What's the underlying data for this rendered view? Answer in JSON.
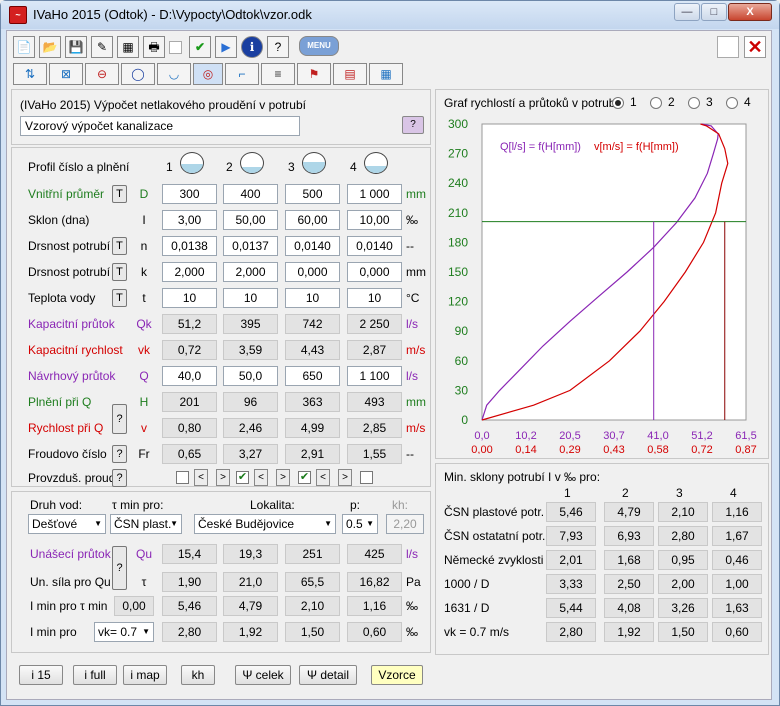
{
  "title": "IVaHo 2015 (Odtok) - D:\\Vypocty\\Odtok\\vzor.odk",
  "window": {
    "minimize": "—",
    "maximize": "□",
    "close": "X"
  },
  "toolbar1": [
    "new-file-icon",
    "open-folder-icon",
    "save-icon",
    "edit-icon",
    "table-icon",
    "print-icon",
    "check-icon",
    "play-icon",
    "info-icon",
    "help-icon",
    "menu-button"
  ],
  "menu_label": "MENU",
  "header": {
    "heading": "(IVaHo 2015) Výpočet netlakového proudění v potrubí",
    "name": "Vzorový výpočet kanalizace",
    "q": "?"
  },
  "profile": {
    "label": "Profil číslo a plnění",
    "numbers": [
      "1",
      "2",
      "3",
      "4"
    ],
    "fills": [
      0.45,
      0.3,
      0.55,
      0.35
    ]
  },
  "rows": [
    {
      "label": "Vnitřní průměr",
      "t": "T",
      "sym": "D",
      "unit": "mm",
      "vals": [
        "300",
        "400",
        "500",
        "1 000"
      ],
      "color": "green",
      "editable": true
    },
    {
      "label": "Sklon (dna)",
      "t": "",
      "sym": "I",
      "unit": "‰",
      "vals": [
        "3,00",
        "50,00",
        "60,00",
        "10,00"
      ],
      "color": "black",
      "editable": true
    },
    {
      "label": "Drsnost potrubí",
      "t": "T",
      "sym": "n",
      "unit": "--",
      "vals": [
        "0,0138",
        "0,0137",
        "0,0140",
        "0,0140"
      ],
      "color": "black",
      "editable": true
    },
    {
      "label": "Drsnost potrubí",
      "t": "T",
      "sym": "k",
      "unit": "mm",
      "vals": [
        "2,000",
        "2,000",
        "0,000",
        "0,000"
      ],
      "color": "black",
      "editable": true
    },
    {
      "label": "Teplota vody",
      "t": "T",
      "sym": "t",
      "unit": "°C",
      "vals": [
        "10",
        "10",
        "10",
        "10"
      ],
      "color": "black",
      "editable": true
    },
    {
      "label": "Kapacitní průtok",
      "t": "",
      "sym": "Qk",
      "unit": "l/s",
      "vals": [
        "51,2",
        "395",
        "742",
        "2 250"
      ],
      "color": "purple",
      "editable": false
    },
    {
      "label": "Kapacitní rychlost",
      "t": "",
      "sym": "vk",
      "unit": "m/s",
      "vals": [
        "0,72",
        "3,59",
        "4,43",
        "2,87"
      ],
      "color": "red",
      "editable": false
    },
    {
      "label": "Návrhový průtok",
      "t": "",
      "sym": "Q",
      "unit": "l/s",
      "vals": [
        "40,0",
        "50,0",
        "650",
        "1 100"
      ],
      "color": "purple",
      "editable": true
    },
    {
      "label": "Plnění při Q",
      "t": "",
      "sym": "H",
      "unit": "mm",
      "vals": [
        "201",
        "96",
        "363",
        "493"
      ],
      "color": "green",
      "editable": false
    },
    {
      "label": "Rychlost při Q",
      "t": "",
      "sym": "v",
      "unit": "m/s",
      "vals": [
        "0,80",
        "2,46",
        "4,99",
        "2,85"
      ],
      "color": "red",
      "editable": false
    },
    {
      "label": "Froudovo číslo",
      "t": "?",
      "sym": "Fr",
      "unit": "--",
      "vals": [
        "0,65",
        "3,27",
        "2,91",
        "1,55"
      ],
      "color": "black",
      "editable": false
    }
  ],
  "qh_button": "?",
  "provzdus": {
    "label": "Provzduš. proud",
    "q": "?",
    "checked": [
      false,
      true,
      true,
      false
    ],
    "lt": "<",
    "gt": ">"
  },
  "lower": {
    "druh_label": "Druh vod:",
    "tau_label": "τ min pro:",
    "lok_label": "Lokalita:",
    "p_label": "p:",
    "kh_label": "kh:",
    "druh": "Dešťové",
    "tau": "ČSN plast.",
    "lokalita": "České Budějovice",
    "p": "0.5",
    "kh": "2,20",
    "rows": [
      {
        "label": "Unášecí průtok",
        "sym": "Qu",
        "unit": "l/s",
        "vals": [
          "15,4",
          "19,3",
          "251",
          "425"
        ],
        "color": "purple"
      },
      {
        "label": "Un. síla pro Qu",
        "sym": "τ",
        "unit": "Pa",
        "vals": [
          "1,90",
          "21,0",
          "65,5",
          "16,82"
        ],
        "color": "black"
      },
      {
        "label": "I min pro τ min",
        "sym": "0,00",
        "unit": "‰",
        "vals": [
          "5,46",
          "4,79",
          "2,10",
          "1,16"
        ],
        "color": "black"
      },
      {
        "label": "I min pro",
        "sym": "vk= 0.7",
        "unit": "‰",
        "vals": [
          "2,80",
          "1,92",
          "1,50",
          "0,60"
        ],
        "color": "black"
      }
    ],
    "q": "?"
  },
  "buttons": [
    "i 15",
    "i full",
    "i map",
    "kh",
    "Ψ celek",
    "Ψ detail",
    "Vzorce"
  ],
  "graph": {
    "label": "Graf rychlostí a průtoků v potrubí",
    "radios": [
      "1",
      "2",
      "3",
      "4"
    ],
    "selected": 0
  },
  "chart_data": {
    "type": "line",
    "title": "",
    "legend": [
      "Q[l/s] = f(H[mm])",
      "v[m/s] = f(H[mm])"
    ],
    "ylim": [
      0,
      300
    ],
    "yticks": [
      "300",
      "270",
      "240",
      "210",
      "180",
      "150",
      "120",
      "90",
      "60",
      "30",
      "0"
    ],
    "xticks_Q": [
      "0,0",
      "10,2",
      "20,5",
      "30,7",
      "41,0",
      "51,2",
      "61,5"
    ],
    "xticks_v": [
      "0,00",
      "0,14",
      "0,29",
      "0,43",
      "0,58",
      "0,72",
      "0,87"
    ],
    "series": [
      {
        "name": "Q[l/s] = f(H[mm])",
        "color": "#8a26b5",
        "x": [
          0,
          1.1,
          4.1,
          8.6,
          14.2,
          20.5,
          27.1,
          33.8,
          40.0,
          45.3,
          49.6,
          52.5,
          53.9,
          54.9,
          55.0,
          53.4,
          51.2
        ],
        "y": [
          0,
          15,
          30,
          50,
          75,
          100,
          125,
          150,
          175,
          200,
          225,
          250,
          270,
          285,
          290,
          298,
          300
        ]
      },
      {
        "name": "v[m/s] = f(H[mm])",
        "color": "#d40000",
        "x": [
          0,
          0.17,
          0.29,
          0.42,
          0.52,
          0.6,
          0.67,
          0.73,
          0.77,
          0.79,
          0.81,
          0.8,
          0.78,
          0.74,
          0.72
        ],
        "y": [
          0,
          15,
          30,
          60,
          90,
          120,
          150,
          180,
          210,
          240,
          260,
          275,
          290,
          298,
          300
        ]
      }
    ],
    "markers": {
      "Q": 40.0,
      "H": 201,
      "v": 0.8
    }
  },
  "smin": {
    "label": "Min. sklony potrubí I v ‰ pro:",
    "cols": [
      "1",
      "2",
      "3",
      "4"
    ],
    "rows": [
      {
        "label": "ČSN plastové potr.",
        "vals": [
          "5,46",
          "4,79",
          "2,10",
          "1,16"
        ]
      },
      {
        "label": "ČSN ostatatní potr.",
        "vals": [
          "7,93",
          "6,93",
          "2,80",
          "1,67"
        ]
      },
      {
        "label": "Německé zvyklosti",
        "vals": [
          "2,01",
          "1,68",
          "0,95",
          "0,46"
        ]
      },
      {
        "label": "1000 / D",
        "vals": [
          "3,33",
          "2,50",
          "2,00",
          "1,00"
        ]
      },
      {
        "label": "1631 / D",
        "vals": [
          "5,44",
          "4,08",
          "3,26",
          "1,63"
        ]
      },
      {
        "label": "vk = 0.7 m/s",
        "vals": [
          "2,80",
          "1,92",
          "1,50",
          "0,60"
        ]
      }
    ]
  }
}
